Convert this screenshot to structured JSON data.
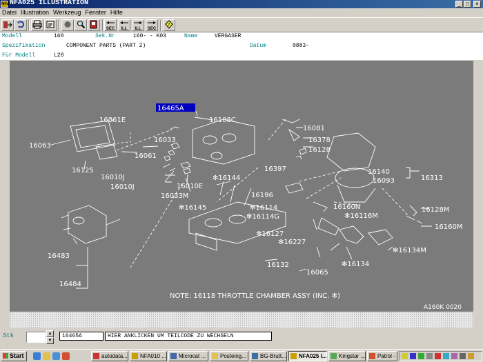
{
  "window": {
    "title": "NFA025 ILLUSTRATION",
    "app_icon_text": "NFA"
  },
  "menu": [
    "Datei",
    "Illustration",
    "Werkzeug",
    "Fenster",
    "Hilfe"
  ],
  "toolbar": {
    "icons": [
      "exit-icon",
      "undo-icon",
      "print-icon",
      "overview-icon",
      "record-icon",
      "zoom-icon",
      "book-icon",
      "section-prev-icon",
      "illustration-prev-icon",
      "illustration-next-icon",
      "section-next-icon",
      "help-icon"
    ],
    "sec_prev": "SEC",
    "ill_prev": "ILL",
    "ill_next": "ILL",
    "sec_next": "SEC"
  },
  "info": {
    "modell_label": "Modell",
    "modell_value": "160",
    "seknr_label": "Sek.Nr",
    "seknr_value": "160- - K03",
    "name_label": "Name",
    "name_value": "VERGASER",
    "spez_label": "Spezifikation",
    "spez_value": "COMPONENT PARTS (PART 2)",
    "datum_label": "Datum",
    "datum_value": "0883-",
    "fuer_label": "Für Modell",
    "fuer_value": "L28"
  },
  "illustration": {
    "selected_part": "16465A",
    "labels": {
      "l16061e": "16061E",
      "l16063": "16063",
      "l16125": "16125",
      "l16061": "16061",
      "l16033": "16033",
      "l16010j_a": "16010J",
      "l16010j_b": "16010J",
      "l16010e": "16010E",
      "l16033m": "16033M",
      "l16108c": "16108C",
      "l16144": "✻16144",
      "l16145": "✻16145",
      "l16114": "✻16114",
      "l16114g": "✻16114G",
      "l16127": "✻16127",
      "l16227": "✻16227",
      "l16132": "16132",
      "l16065": "16065",
      "l16134": "✻16134",
      "l16134m": "✻16134M",
      "l16116m": "✻16116M",
      "l16160n": "16160N",
      "l16196": "16196",
      "l16397": "16397",
      "l16081": "16081",
      "l16378": "16378",
      "l16128": "16128",
      "l16140": "16140",
      "l16093": "16093",
      "l16313": "16313",
      "l16128m": "16128M",
      "l16160m": "16160M",
      "l16483": "16483",
      "l16484": "16484"
    },
    "note": "NOTE: 16118 THROTTLE CHAMBER ASSY (INC. ✻)",
    "code": "A160K 0020"
  },
  "status": {
    "stk_label": "Stk",
    "qty_value": "",
    "part_code": "16465A",
    "hint": "HIER ANKLICKEN UM TEILCODE ZU WECHSELN"
  },
  "taskbar": {
    "start": "Start",
    "tasks": [
      "autodata...",
      "NFA010 ...",
      "Microcat ...",
      "Posteing...",
      "BG-Brutt...",
      "NFA025 I...",
      "Kingstar ...",
      "Patrol - N..."
    ]
  }
}
